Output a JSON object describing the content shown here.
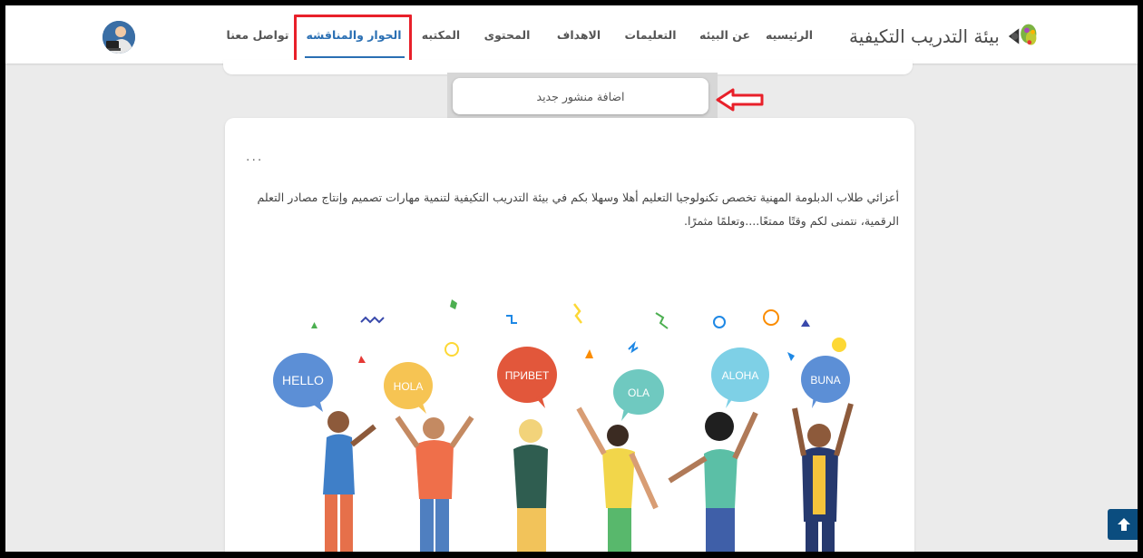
{
  "site": {
    "logo_text": "بيئة التدريب التكيفية"
  },
  "nav": {
    "items": [
      {
        "label": "الرئيسيه",
        "active": false
      },
      {
        "label": "عن البيئه",
        "active": false
      },
      {
        "label": "التعليمات",
        "active": false
      },
      {
        "label": "الاهداف",
        "active": false
      },
      {
        "label": "المحتوى",
        "active": false
      },
      {
        "label": "المكتبه",
        "active": false
      },
      {
        "label": "الحوار والمناقشه",
        "active": true
      },
      {
        "label": "تواصل معنا",
        "active": false
      }
    ]
  },
  "forum": {
    "add_post_label": "اضافة منشور جديد",
    "post": {
      "menu": "...",
      "text": "أعزائي طلاب الدبلومة المهنية تخصص تكنولوجيا التعليم أهلا وسهلا بكم في بيئة التدريب التكيفية لتنمية مهارات تصميم وإنتاج مصادر التعلم الرقمية، نتمنى لكم وقتًا ممتعًا....وتعلمًا مثمرًا.",
      "bubbles": [
        "HELLO",
        "HOLA",
        "ПРИВЕТ",
        "OLA",
        "ALOHA",
        "BUNA"
      ]
    }
  },
  "colors": {
    "accent": "#2a6fb3",
    "highlight": "#e8202a",
    "scroll_button": "#0b4d7f"
  },
  "icons": {
    "scroll_top": "arrow-up-icon",
    "logo": "leaf-logo-icon",
    "annotation": "left-arrow-annotation-icon"
  }
}
